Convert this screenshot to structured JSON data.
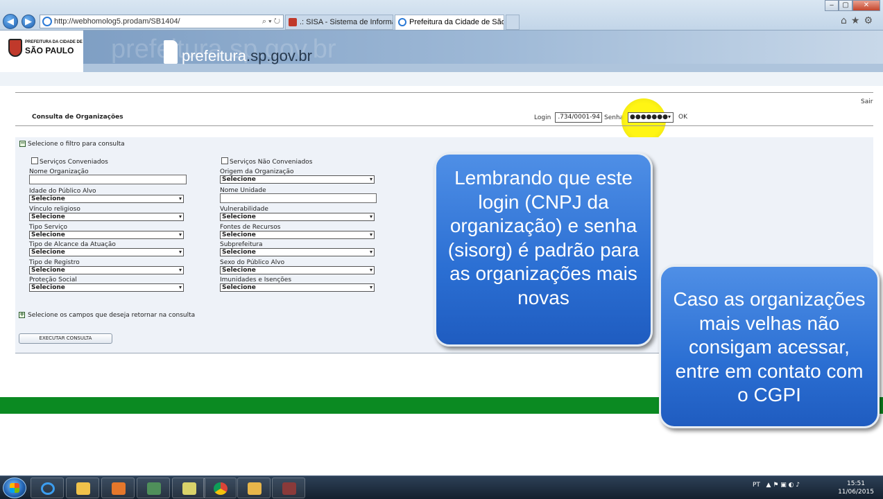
{
  "browser": {
    "address_url": "http://webhomolog5.prodam/SB1404/",
    "address_host_part": "webhomolog5",
    "tabs": [
      {
        "label": ".: SISA - Sistema de Informaçã...",
        "active": false
      },
      {
        "label": "Prefeitura da Cidade de São...",
        "active": true
      }
    ],
    "nav": {
      "back_icon": "back-arrow-icon",
      "forward_icon": "forward-arrow-icon"
    },
    "window_controls": {
      "minimize": "‒",
      "maximize": "▢",
      "close": "✕"
    },
    "toolbar_icons": [
      "home-icon",
      "star-icon",
      "gear-icon"
    ]
  },
  "site": {
    "logo_line1": "PREFEITURA DA CIDADE DE",
    "logo_line2": "SÃO PAULO",
    "title_main": "prefeitura",
    "title_domain": ".sp.gov.br",
    "ghost_text": "prefeitura.sp.gov.br"
  },
  "page": {
    "sair": "Sair",
    "title": "Consulta de Organizações",
    "login_label": "Login",
    "login_value": ".734/0001-94",
    "senha_label": "Senha",
    "senha_value": "●●●●●●●",
    "ok_label": "OK"
  },
  "filters": {
    "heading": "Selecione o filtro para consulta",
    "check_conveniados": "Serviços Conveniados",
    "check_nao_conveniados": "Serviços Não Conveniados",
    "fields_left": [
      {
        "label": "Nome Organização",
        "kind": "text",
        "value": ""
      },
      {
        "label": "Idade do Público Alvo",
        "kind": "select",
        "value": "Selecione"
      },
      {
        "label": "Vínculo religioso",
        "kind": "select",
        "value": "Selecione"
      },
      {
        "label": "Tipo Serviço",
        "kind": "select",
        "value": "Selecione"
      },
      {
        "label": "Tipo de Alcance da Atuação",
        "kind": "select",
        "value": "Selecione"
      },
      {
        "label": "Tipo de Registro",
        "kind": "select",
        "value": "Selecione"
      },
      {
        "label": "Proteção Social",
        "kind": "select",
        "value": "Selecione"
      }
    ],
    "fields_right": [
      {
        "label": "Origem da Organização",
        "kind": "select",
        "value": "Selecione"
      },
      {
        "label": "Nome Unidade",
        "kind": "text",
        "value": ""
      },
      {
        "label": "Vulnerabilidade",
        "kind": "select",
        "value": "Selecione"
      },
      {
        "label": "Fontes de Recursos",
        "kind": "select",
        "value": "Selecione"
      },
      {
        "label": "Subprefeitura",
        "kind": "select",
        "value": "Selecione"
      },
      {
        "label": "Sexo do Público Alvo",
        "kind": "select",
        "value": "Selecione"
      },
      {
        "label": "Imunidades e Isenções",
        "kind": "select",
        "value": "Selecione"
      }
    ],
    "campos_heading": "Selecione os campos que deseja retornar na consulta",
    "execute_label": "EXECUTAR CONSULTA"
  },
  "callouts": {
    "callout1": "Lembrando que este login (CNPJ da organização) e senha (sisorg) é padrão para as organizações mais novas",
    "callout2": "Caso as organizações mais velhas não consigam acessar, entre em contato com o CGPI"
  },
  "taskbar": {
    "items": [
      "internet-explorer-icon",
      "folder-icon",
      "media-player-icon",
      "network-icon",
      "file-manager-icon",
      "chrome-icon",
      "mail-icon",
      "tool-icon"
    ],
    "language": "PT",
    "time": "15:51",
    "date": "11/06/2015"
  },
  "colors": {
    "green_bar": "#0b8a22",
    "callout_blue": "#2b6fd3",
    "highlight_yellow": "#fff400"
  }
}
